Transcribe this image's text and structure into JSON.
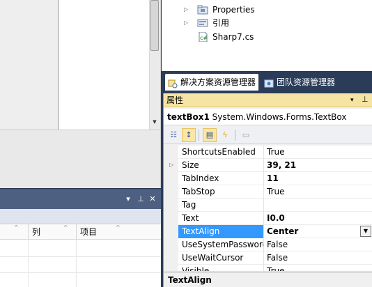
{
  "solution_explorer": {
    "items": [
      {
        "label": "Properties",
        "icon": "properties-folder-icon",
        "expandable": true
      },
      {
        "label": "引用",
        "icon": "references-icon",
        "expandable": true
      },
      {
        "label": "Sharp7.cs",
        "icon": "csharp-file-icon",
        "expandable": false
      }
    ]
  },
  "tabs": [
    {
      "label": "解决方案资源管理器",
      "icon": "solution-explorer-icon",
      "active": true
    },
    {
      "label": "团队资源管理器",
      "icon": "team-explorer-icon",
      "active": false
    }
  ],
  "properties": {
    "title": "属性",
    "object_name": "textBox1",
    "object_type": "System.Windows.Forms.TextBox",
    "rows": [
      {
        "name": "ShortcutsEnabled",
        "value": "True",
        "bold": false,
        "expandable": false
      },
      {
        "name": "Size",
        "value": "39, 21",
        "bold": true,
        "expandable": true
      },
      {
        "name": "TabIndex",
        "value": "11",
        "bold": true,
        "expandable": false
      },
      {
        "name": "TabStop",
        "value": "True",
        "bold": false,
        "expandable": false
      },
      {
        "name": "Tag",
        "value": "",
        "bold": false,
        "expandable": false
      },
      {
        "name": "Text",
        "value": "I0.0",
        "bold": true,
        "expandable": false
      },
      {
        "name": "TextAlign",
        "value": "Center",
        "bold": true,
        "expandable": false,
        "selected": true
      },
      {
        "name": "UseSystemPasswordChar",
        "value": "False",
        "bold": false,
        "expandable": false
      },
      {
        "name": "UseWaitCursor",
        "value": "False",
        "bold": false,
        "expandable": false
      },
      {
        "name": "Visible",
        "value": "True",
        "bold": false,
        "expandable": false
      }
    ],
    "description_title": "TextAlign"
  },
  "bottom_panel": {
    "columns": [
      "",
      "列",
      "项目"
    ]
  },
  "colors": {
    "ide_frame": "#2b3c59",
    "tool_title_active": "#f5e4a4",
    "selection": "#3399ff"
  }
}
